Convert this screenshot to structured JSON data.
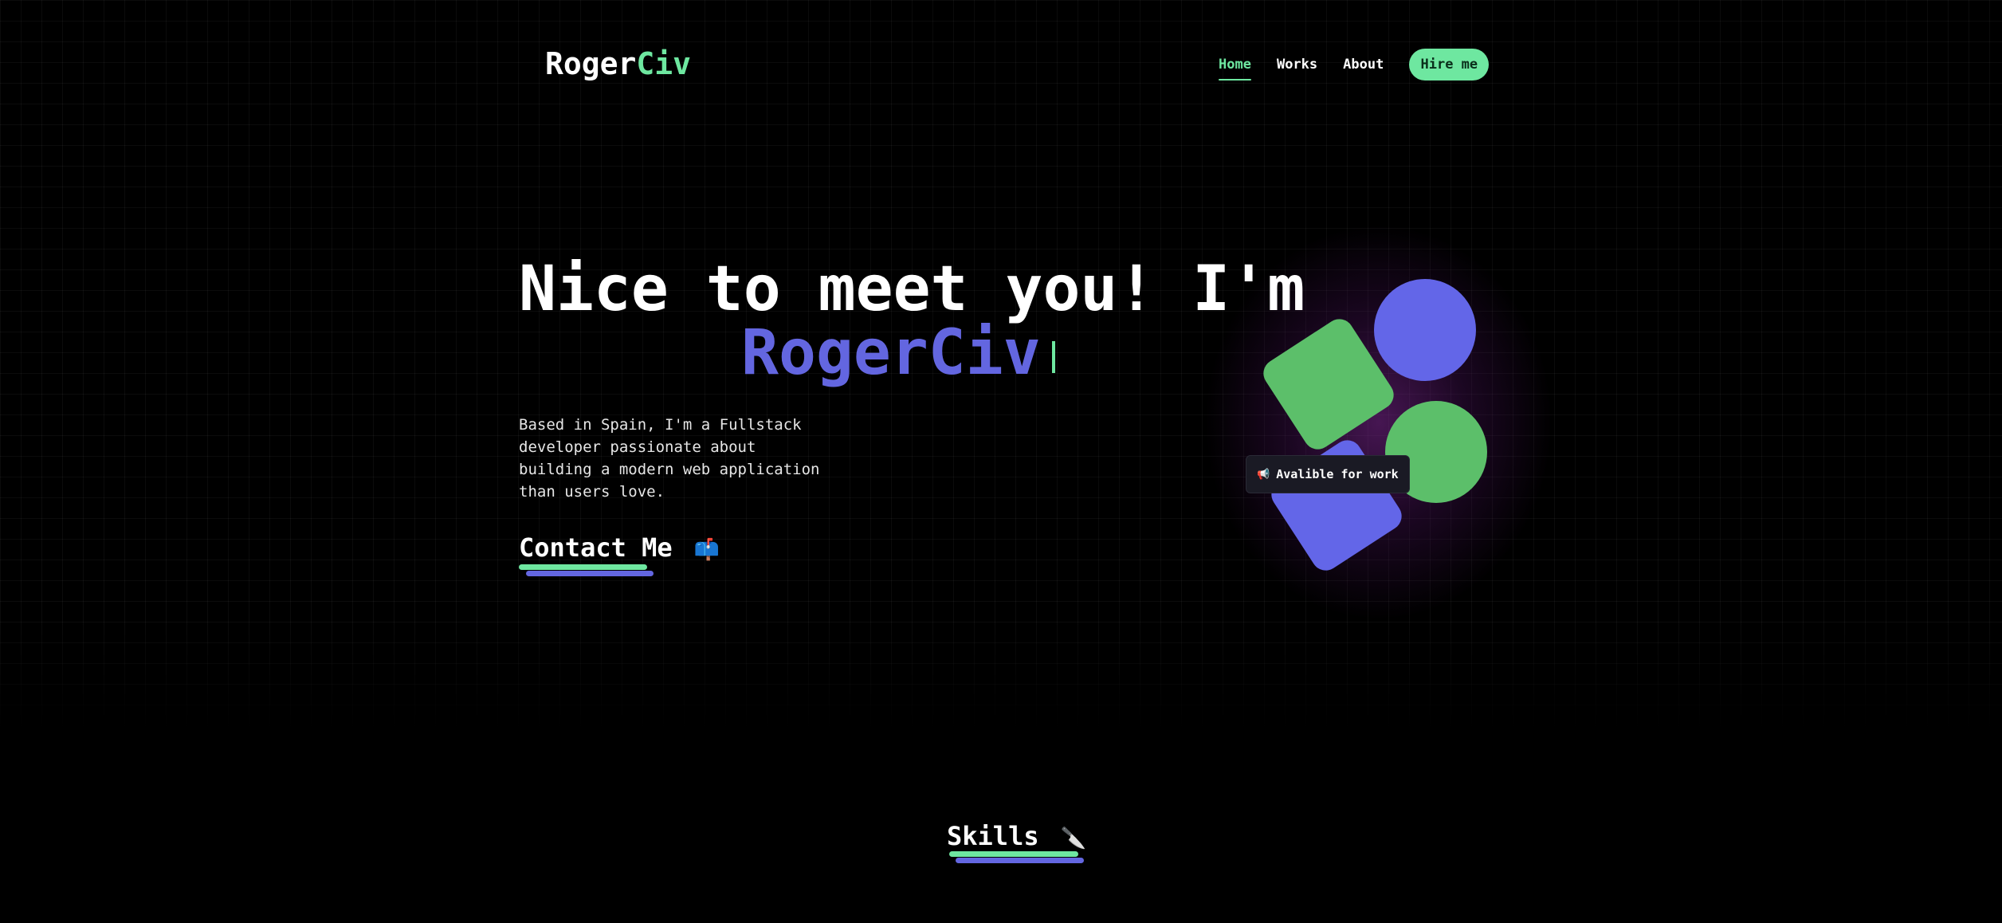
{
  "header": {
    "logo_main": "Roger",
    "logo_accent": "Civ",
    "nav": {
      "home": "Home",
      "works": "Works",
      "about": "About"
    },
    "hire_label": "Hire me"
  },
  "hero": {
    "title_line1": "Nice to meet you! I'm",
    "title_name": "RogerCiv",
    "description": "Based in Spain, I'm a Fullstack developer passionate about building a modern web application than users love.",
    "contact_label": "Contact Me",
    "contact_emoji": "📫"
  },
  "badge": {
    "emoji": "📢",
    "label": "Avalible for work"
  },
  "skills": {
    "title": "Skills",
    "emoji": "🔪"
  },
  "colors": {
    "background": "#000000",
    "accent_green": "#6ee7a0",
    "accent_blue": "#6366e0",
    "shape_green": "#5cbf6a",
    "shape_blue": "#6366e8"
  },
  "icons": {
    "contact": "mailbox-icon",
    "badge": "megaphone-icon",
    "skills": "knife-icon"
  }
}
